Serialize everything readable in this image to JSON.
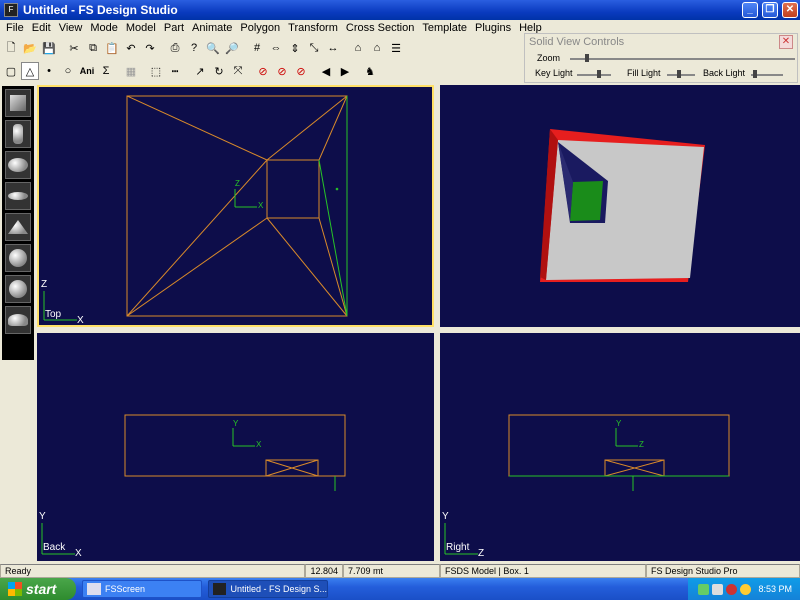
{
  "window": {
    "title": "Untitled - FS Design Studio",
    "icon": "fs-app-icon"
  },
  "menu": [
    "File",
    "Edit",
    "View",
    "Mode",
    "Model",
    "Part",
    "Animate",
    "Polygon",
    "Transform",
    "Cross Section",
    "Template",
    "Plugins",
    "Help"
  ],
  "toolbar2": {
    "ani_label": "Ani",
    "sigma_label": "Σ"
  },
  "panel": {
    "title": "Solid View Controls",
    "zoom_label": "Zoom",
    "key_light_label": "Key Light",
    "fill_light_label": "Fill Light",
    "back_light_label": "Back Light"
  },
  "viewports": {
    "top": {
      "label": "Top",
      "axis_v": "Z",
      "axis_h": "X",
      "origin_v": "Z",
      "origin_h": "X"
    },
    "back": {
      "label": "Back",
      "axis_v": "Y",
      "axis_h": "X",
      "origin_v": "Y",
      "origin_h": "X"
    },
    "right": {
      "label": "Right",
      "axis_v": "Y",
      "axis_h": "Z",
      "origin_v": "Y",
      "origin_h": "Z"
    }
  },
  "status": {
    "ready": "Ready",
    "coord_x": "12.804",
    "coord_y": "7.709 mt",
    "model": "FSDS Model | Box. 1",
    "product": "FS Design Studio Pro"
  },
  "taskbar": {
    "start_label": "start",
    "tasks": [
      "FSScreen",
      "Untitled - FS Design S..."
    ],
    "clock": "8:53 PM"
  },
  "colors": {
    "viewport_bg": "#0d0d4a",
    "wire_orange": "#d98a2a",
    "wire_green": "#27c427",
    "active_border": "#ffe066",
    "box_face": "#c8c8c8",
    "box_top": "#e61e1e",
    "box_inset": "#1a8c1a"
  }
}
